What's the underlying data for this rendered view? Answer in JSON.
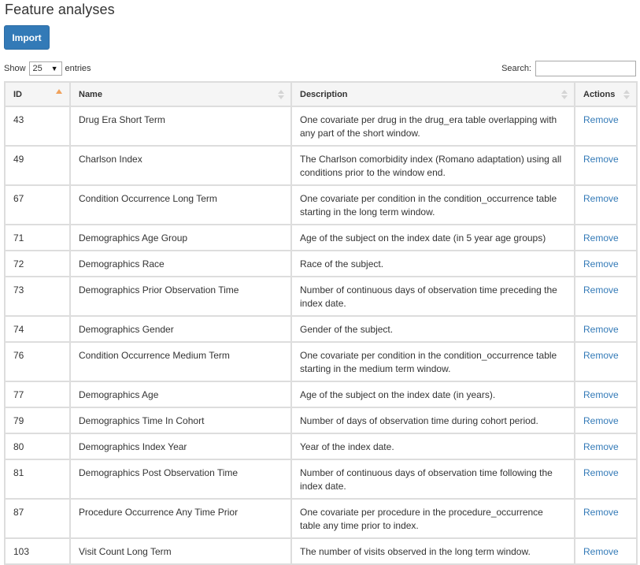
{
  "page": {
    "title": "Feature analyses"
  },
  "toolbar": {
    "import_label": "Import"
  },
  "length": {
    "prefix": "Show",
    "value": "25",
    "suffix": "entries"
  },
  "search": {
    "label": "Search:",
    "value": ""
  },
  "table": {
    "headers": {
      "id": "ID",
      "name": "Name",
      "description": "Description",
      "actions": "Actions"
    },
    "rows": [
      {
        "id": "43",
        "name": "Drug Era Short Term",
        "description": "One covariate per drug in the drug_era table overlapping with any part of the short window.",
        "action": "Remove"
      },
      {
        "id": "49",
        "name": "Charlson Index",
        "description": "The Charlson comorbidity index (Romano adaptation) using all conditions prior to the window end.",
        "action": "Remove"
      },
      {
        "id": "67",
        "name": "Condition Occurrence Long Term",
        "description": "One covariate per condition in the condition_occurrence table starting in the long term window.",
        "action": "Remove"
      },
      {
        "id": "71",
        "name": "Demographics Age Group",
        "description": "Age of the subject on the index date (in 5 year age groups)",
        "action": "Remove"
      },
      {
        "id": "72",
        "name": "Demographics Race",
        "description": "Race of the subject.",
        "action": "Remove"
      },
      {
        "id": "73",
        "name": "Demographics Prior Observation Time",
        "description": "Number of continuous days of observation time preceding the index date.",
        "action": "Remove"
      },
      {
        "id": "74",
        "name": "Demographics Gender",
        "description": "Gender of the subject.",
        "action": "Remove"
      },
      {
        "id": "76",
        "name": "Condition Occurrence Medium Term",
        "description": "One covariate per condition in the condition_occurrence table starting in the medium term window.",
        "action": "Remove"
      },
      {
        "id": "77",
        "name": "Demographics Age",
        "description": "Age of the subject on the index date (in years).",
        "action": "Remove"
      },
      {
        "id": "79",
        "name": "Demographics Time In Cohort",
        "description": "Number of days of observation time during cohort period.",
        "action": "Remove"
      },
      {
        "id": "80",
        "name": "Demographics Index Year",
        "description": "Year of the index date.",
        "action": "Remove"
      },
      {
        "id": "81",
        "name": "Demographics Post Observation Time",
        "description": "Number of continuous days of observation time following the index date.",
        "action": "Remove"
      },
      {
        "id": "87",
        "name": "Procedure Occurrence Any Time Prior",
        "description": "One covariate per procedure in the procedure_occurrence table any time prior to index.",
        "action": "Remove"
      },
      {
        "id": "103",
        "name": "Visit Count Long Term",
        "description": "The number of visits observed in the long term window.",
        "action": "Remove"
      }
    ]
  },
  "colors": {
    "accent": "#337ab7",
    "sort_active": "#f0a15b",
    "border": "#dddddd",
    "header_bg": "#f5f5f5"
  }
}
